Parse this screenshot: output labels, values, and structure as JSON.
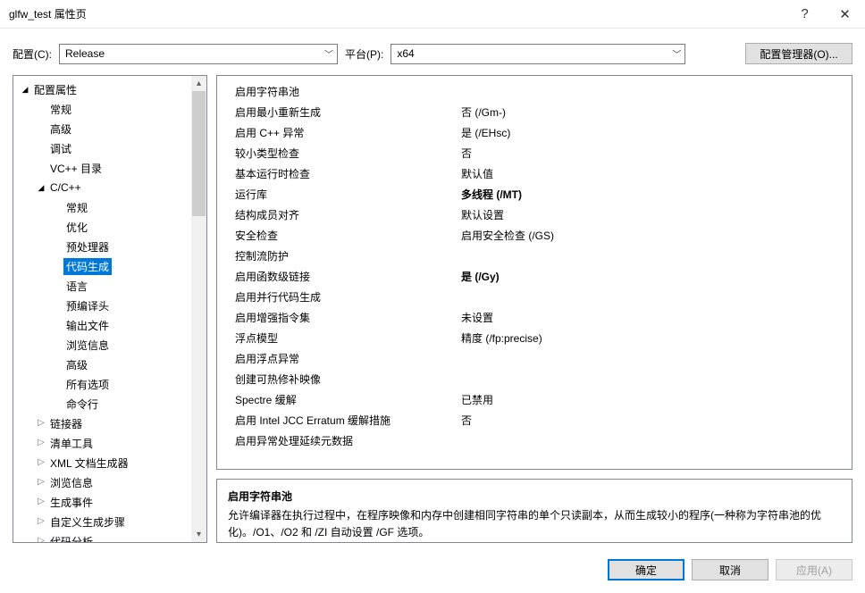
{
  "title": "glfw_test 属性页",
  "config": {
    "label": "配置(C):",
    "value": "Release"
  },
  "platform": {
    "label": "平台(P):",
    "value": "x64"
  },
  "manager_btn": "配置管理器(O)...",
  "tree": [
    {
      "label": "配置属性",
      "depth": 0,
      "arrow": "open"
    },
    {
      "label": "常规",
      "depth": 1,
      "arrow": "none"
    },
    {
      "label": "高级",
      "depth": 1,
      "arrow": "none"
    },
    {
      "label": "调试",
      "depth": 1,
      "arrow": "none"
    },
    {
      "label": "VC++ 目录",
      "depth": 1,
      "arrow": "none"
    },
    {
      "label": "C/C++",
      "depth": 1,
      "arrow": "open"
    },
    {
      "label": "常规",
      "depth": 2,
      "arrow": "none"
    },
    {
      "label": "优化",
      "depth": 2,
      "arrow": "none"
    },
    {
      "label": "预处理器",
      "depth": 2,
      "arrow": "none"
    },
    {
      "label": "代码生成",
      "depth": 2,
      "arrow": "none",
      "selected": true
    },
    {
      "label": "语言",
      "depth": 2,
      "arrow": "none"
    },
    {
      "label": "预编译头",
      "depth": 2,
      "arrow": "none"
    },
    {
      "label": "输出文件",
      "depth": 2,
      "arrow": "none"
    },
    {
      "label": "浏览信息",
      "depth": 2,
      "arrow": "none"
    },
    {
      "label": "高级",
      "depth": 2,
      "arrow": "none"
    },
    {
      "label": "所有选项",
      "depth": 2,
      "arrow": "none"
    },
    {
      "label": "命令行",
      "depth": 2,
      "arrow": "none"
    },
    {
      "label": "链接器",
      "depth": 1,
      "arrow": "closed"
    },
    {
      "label": "清单工具",
      "depth": 1,
      "arrow": "closed"
    },
    {
      "label": "XML 文档生成器",
      "depth": 1,
      "arrow": "closed"
    },
    {
      "label": "浏览信息",
      "depth": 1,
      "arrow": "closed"
    },
    {
      "label": "生成事件",
      "depth": 1,
      "arrow": "closed"
    },
    {
      "label": "自定义生成步骤",
      "depth": 1,
      "arrow": "closed"
    },
    {
      "label": "代码分析",
      "depth": 1,
      "arrow": "closed"
    }
  ],
  "properties": [
    {
      "name": "启用字符串池",
      "value": ""
    },
    {
      "name": "启用最小重新生成",
      "value": "否 (/Gm-)"
    },
    {
      "name": "启用 C++ 异常",
      "value": "是 (/EHsc)"
    },
    {
      "name": "较小类型检查",
      "value": "否"
    },
    {
      "name": "基本运行时检查",
      "value": "默认值"
    },
    {
      "name": "运行库",
      "value": "多线程 (/MT)",
      "bold": true
    },
    {
      "name": "结构成员对齐",
      "value": "默认设置"
    },
    {
      "name": "安全检查",
      "value": "启用安全检查 (/GS)"
    },
    {
      "name": "控制流防护",
      "value": ""
    },
    {
      "name": "启用函数级链接",
      "value": "是 (/Gy)",
      "bold": true
    },
    {
      "name": "启用并行代码生成",
      "value": ""
    },
    {
      "name": "启用增强指令集",
      "value": "未设置"
    },
    {
      "name": "浮点模型",
      "value": "精度 (/fp:precise)"
    },
    {
      "name": "启用浮点异常",
      "value": ""
    },
    {
      "name": "创建可热修补映像",
      "value": ""
    },
    {
      "name": "Spectre 缓解",
      "value": "已禁用"
    },
    {
      "name": "启用 Intel JCC Erratum 缓解措施",
      "value": "否"
    },
    {
      "name": "启用异常处理延续元数据",
      "value": ""
    }
  ],
  "description": {
    "title": "启用字符串池",
    "text": "允许编译器在执行过程中，在程序映像和内存中创建相同字符串的单个只读副本，从而生成较小的程序(一种称为字符串池的优化)。/O1、/O2 和 /ZI 自动设置 /GF 选项。"
  },
  "buttons": {
    "ok": "确定",
    "cancel": "取消",
    "apply": "应用(A)"
  }
}
